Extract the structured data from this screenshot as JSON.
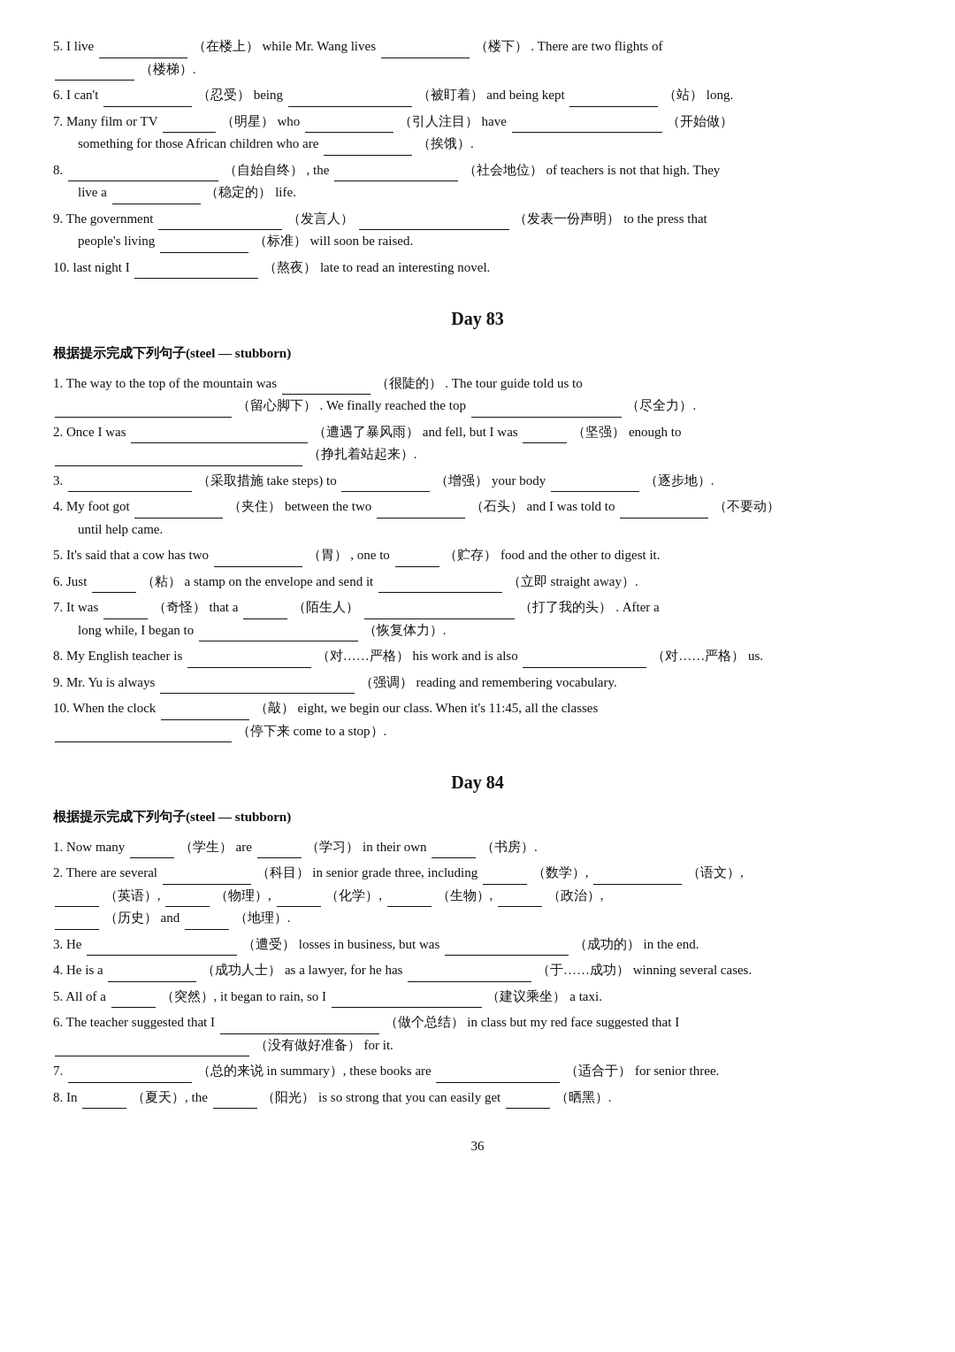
{
  "prev_exercises": [
    {
      "num": "5.",
      "text": "I live",
      "blank1": "",
      "hint1": "（在楼上）",
      "mid1": "while Mr. Wang lives",
      "blank2": "",
      "hint2": "（楼下）",
      "mid2": ". There are two flights of",
      "blank3": "",
      "hint3": "（楼梯）."
    },
    {
      "num": "6.",
      "text": "I can't",
      "blank1": "",
      "hint1": "（忍受）",
      "mid1": "being",
      "blank2": "",
      "hint2": "（被盯着）",
      "mid2": "and being kept",
      "blank3": "",
      "hint3": "（站）",
      "end": "long."
    },
    {
      "num": "7.",
      "text": "Many film or TV",
      "blank1": "",
      "hint1": "（明星）",
      "mid1": "who",
      "blank2": "",
      "hint2": "（引人注目）",
      "mid2": "have",
      "blank3": "",
      "hint3": "（开始做）",
      "line2": "something for those African children who are",
      "blank4": "",
      "hint4": "（挨饿）."
    },
    {
      "num": "8.",
      "blank1": "",
      "hint1": "（自始自终）",
      "mid1": ", the",
      "blank2": "",
      "hint2": "（社会地位）",
      "mid2": "of teachers is not that high. They",
      "line2": "live a",
      "blank3": "",
      "hint3": "（稳定的）",
      "end": "life."
    },
    {
      "num": "9.",
      "text": "The government",
      "blank1": "",
      "hint1": "（发言人）",
      "blank2": "",
      "hint2": "（发表一份声明）",
      "mid2": "to the press that",
      "line2": "people's living",
      "blank3": "",
      "hint3": "（标准）",
      "end": "will soon be raised."
    },
    {
      "num": "10.",
      "text": "last night I",
      "blank1": "",
      "hint1": "（熬夜）",
      "end": "late to read an interesting novel."
    }
  ],
  "day83": {
    "title": "Day 83",
    "subtitle": "根据提示完成下列句子(steel — stubborn)",
    "exercises": [
      {
        "num": "1.",
        "text": "The way to the top of the mountain was",
        "blank1_size": "md",
        "hint1": "（很陡的）",
        "mid1": ". The tour guide told us to",
        "line2": "",
        "blank2_size": "lg",
        "hint2": "（留心脚下）",
        "mid2": ". We finally reached the top",
        "blank3_size": "lg",
        "hint3": "（尽全力）."
      },
      {
        "num": "2.",
        "text": "Once I was",
        "blank1_size": "xl",
        "hint1": "（遭遇了暴风雨）",
        "mid1": "and fell, but I was",
        "blank2_size": "sm",
        "hint2": "（坚强）",
        "mid2": "enough to",
        "line2": "",
        "blank3_size": "xl",
        "hint3": "（挣扎着站起来）."
      },
      {
        "num": "3.",
        "blank1_size": "lg",
        "hint1": "（采取措施",
        "mid1": "take steps) to",
        "blank2_size": "md",
        "hint2": "（增强）",
        "mid2": "your body",
        "blank3_size": "md",
        "hint3": "（逐步地）."
      },
      {
        "num": "4.",
        "text": "My foot got",
        "blank1_size": "md",
        "hint1": "（夹住）",
        "mid1": "between the two",
        "blank2_size": "md",
        "hint2": "（石头）",
        "mid2": "and I was told to",
        "blank3_size": "md",
        "hint3": "（不要动）",
        "line2": "until help came."
      },
      {
        "num": "5.",
        "text": "It's said that a cow has two",
        "blank1_size": "md",
        "hint1": "（胃）",
        "mid1": ", one to",
        "blank2_size": "sm",
        "hint2": "（贮存）",
        "mid2": "food and the other to digest it."
      },
      {
        "num": "6.",
        "text": "Just",
        "blank1_size": "sm",
        "hint1": "（粘）",
        "mid1": "a stamp on the envelope and send it",
        "blank2_size": "lg",
        "hint2": "（立即 straight away）."
      },
      {
        "num": "7.",
        "text": "It was",
        "blank1_size": "sm",
        "hint1": "（奇怪）",
        "mid1": "that a",
        "blank2_size": "sm",
        "hint2": "（陌生人）",
        "blank3_size": "xl",
        "hint3": "（打了我的头）",
        "mid3": ". After a",
        "line2": "long while, I began to",
        "blank4_size": "xl",
        "hint4": "（恢复体力）."
      },
      {
        "num": "8.",
        "text": "My English teacher is",
        "blank1_size": "md",
        "hint1": "（对……严格）",
        "mid1": "his work and is also",
        "blank2_size": "md",
        "hint2": "（对……严格）",
        "end": "us."
      },
      {
        "num": "9.",
        "text": "Mr. Yu is always",
        "blank1_size": "xl",
        "hint1": "（强调）",
        "end": "reading and remembering vocabulary."
      },
      {
        "num": "10.",
        "text": "When the clock",
        "blank1_size": "md",
        "hint1": "（敲）",
        "mid1": "eight, we begin our class. When it's 11:45, all the classes",
        "line2": "",
        "blank2_size": "xl",
        "hint2": "（停下来 come to a stop）."
      }
    ]
  },
  "day84": {
    "title": "Day 84",
    "subtitle": "根据提示完成下列句子(steel — stubborn)",
    "exercises": [
      {
        "num": "1.",
        "text": "Now many",
        "blank1_size": "sm",
        "hint1": "（学生）",
        "mid1": "are",
        "blank2_size": "sm",
        "hint2": "（学习）",
        "mid2": "in their own",
        "blank3_size": "sm",
        "hint3": "（书房）."
      },
      {
        "num": "2.",
        "text": "There are several",
        "blank1_size": "md",
        "hint1": "（科目）",
        "mid1": "in senior grade three, including",
        "blank2_size": "sm",
        "hint2": "（数学）,",
        "blank3_size": "md",
        "hint3": "（语文）,",
        "line2a": "",
        "blank4_size": "sm",
        "hint4": "（英语）,",
        "blank5_size": "sm",
        "hint5": "（物理）,",
        "blank6_size": "sm",
        "hint6": "（化学）,",
        "blank7_size": "sm",
        "hint7": "（生物）,",
        "blank8_size": "sm",
        "hint8": "（政治）,",
        "line2b": "",
        "blank9_size": "sm",
        "hint9": "（历史）",
        "mid9": "and",
        "blank10_size": "sm",
        "hint10": "（地理）."
      },
      {
        "num": "3.",
        "text": "He",
        "blank1_size": "lg",
        "hint1": "（遭受）",
        "mid1": "losses in business, but was",
        "blank2_size": "lg",
        "hint2": "（成功的）",
        "end": "in the end."
      },
      {
        "num": "4.",
        "text": "He is a",
        "blank1_size": "md",
        "hint1": "（成功人士）",
        "mid1": "as a lawyer, for he has",
        "blank2_size": "lg",
        "hint2": "（于……成功）",
        "end": "winning several cases."
      },
      {
        "num": "5.",
        "text": "All of a",
        "blank1_size": "sm",
        "hint1": "（突然）,",
        "mid1": "it began to rain, so I",
        "blank2_size": "xl",
        "hint2": "（建议乘坐）",
        "end": "a taxi."
      },
      {
        "num": "6.",
        "text": "The teacher suggested that I",
        "blank1_size": "xl",
        "hint1": "（做个总结）",
        "mid1": "in class but my red face suggested that I",
        "line2": "",
        "blank2_size": "xl",
        "hint2": "（没有做好准备）",
        "end": "for it."
      },
      {
        "num": "7.",
        "blank1_size": "lg",
        "hint1": "（总的来说 in summary）,",
        "mid1": "these books are",
        "blank2_size": "lg",
        "hint2": "（适合于）",
        "end": "for senior three."
      },
      {
        "num": "8.",
        "text": "In",
        "blank1_size": "sm",
        "hint1": "（夏天）,",
        "mid1": "the",
        "blank2_size": "sm",
        "hint2": "（阳光）",
        "mid2": "is so strong that you can easily get",
        "blank3_size": "sm",
        "hint3": "（晒黑）."
      }
    ]
  },
  "page_number": "36"
}
